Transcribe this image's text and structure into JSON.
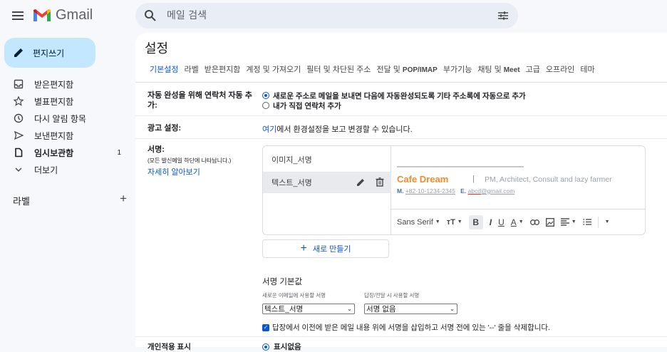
{
  "header": {
    "app_name": "Gmail",
    "search_placeholder": "메일 검색"
  },
  "sidebar": {
    "compose_label": "편지쓰기",
    "items": [
      {
        "label": "받은편지함",
        "icon": "inbox-icon"
      },
      {
        "label": "별표편지함",
        "icon": "star-icon"
      },
      {
        "label": "다시 알림 항목",
        "icon": "clock-icon"
      },
      {
        "label": "보낸편지함",
        "icon": "send-icon"
      },
      {
        "label": "임시보관함",
        "icon": "draft-icon",
        "count": "1"
      },
      {
        "label": "더보기",
        "icon": "chevron-down-icon"
      }
    ],
    "labels_heading": "라벨"
  },
  "settings": {
    "title": "설정",
    "tabs": [
      "기본설정",
      "라벨",
      "받은편지함",
      "계정 및 가져오기",
      "필터 및 차단된 주소",
      "전달 및",
      "POP/IMAP",
      "부가기능",
      "채팅 및",
      "Meet",
      "고급",
      "오프라인",
      "테마"
    ],
    "autocomplete": {
      "label": "자동 완성을 위해 연락처 자동 추가:",
      "option1": "새로운 주소로 메일을 보내면 다음에 자동완성되도록 기타 주소록에 자동으로 추가",
      "option2": "내가 직접 연락처 추가"
    },
    "ads": {
      "label": "광고 설정:",
      "link": "여기",
      "text": "에서 환경설정을 보고 변경할 수 있습니다."
    },
    "signature": {
      "label": "서명:",
      "sublabel": "(모든 발신메일 하단에 나타납니다.)",
      "learn_more": "자세히 알아보기",
      "list": [
        "이미지_서명",
        "텍스트_서명"
      ],
      "editor": {
        "name": "Cafe Dream",
        "separator": "|",
        "role": "PM, Architect, Consult and lazy farmer",
        "mobile_key": "M.",
        "mobile": "+82-10-1234-2345",
        "email_key": "E.",
        "email_user": "abcd",
        "email_domain": "@gmail.com"
      },
      "toolbar_font": "Sans Serif",
      "new_button": "새로 만들기",
      "defaults_title": "서명 기본값",
      "new_mail_label": "새로운 이메일에 사용할 서명",
      "reply_label": "답장/전달 시 사용할 서명",
      "new_mail_value": "텍스트_서명",
      "reply_value": "서명 없음",
      "insert_before_reply": "답장에서 이전에 받은 메일 내용 위에 서명을 삽입하고 서명 전에 있는 '--' 줄을 삭제합니다."
    },
    "cut_row_label": "개인적용 표시",
    "cut_row_value": "표시없음"
  },
  "colors": {
    "accent": "#0b57d0",
    "compose_bg": "#c2e7ff",
    "signature_name": "#f28b2c"
  }
}
